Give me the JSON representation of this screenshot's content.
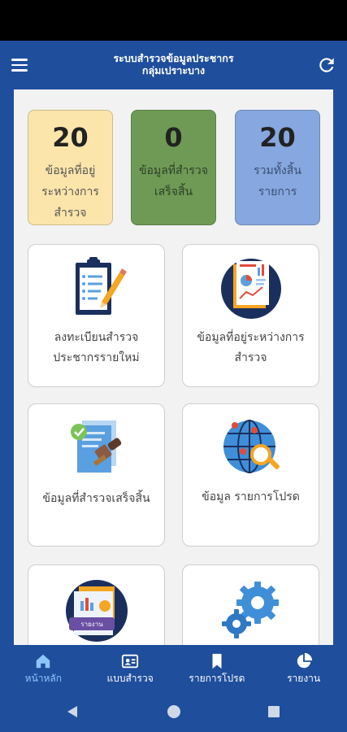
{
  "app": {
    "title_line1": "ระบบสำรวจข้อมูลประชากร",
    "title_line2": "กลุ่มเปราะบาง"
  },
  "stats": [
    {
      "value": "20",
      "label": "ข้อมูลที่อยู่ระหว่างการสำรวจ"
    },
    {
      "value": "0",
      "label": "ข้อมูลที่สำรวจเสร็จสิ้น"
    },
    {
      "value": "20",
      "label": "รวมทั้งสิ้น รายการ"
    }
  ],
  "tiles": [
    {
      "label": "ลงทะเบียนสำรวจ ประชากรรายใหม่"
    },
    {
      "label": "ข้อมูลที่อยู่ระหว่างการ สำรวจ"
    },
    {
      "label": "ข้อมูลที่สำรวจเสร็จสิ้น"
    },
    {
      "label": "ข้อมูล รายการโปรด"
    },
    {
      "badge": "รายงาน"
    }
  ],
  "bottom_nav": [
    {
      "label": "หน้าหลัก",
      "icon": "home-icon",
      "active": true
    },
    {
      "label": "แบบสำรวจ",
      "icon": "id-card-icon"
    },
    {
      "label": "รายการโปรด",
      "icon": "bookmark-icon"
    },
    {
      "label": "รายงาน",
      "icon": "pie-chart-icon"
    }
  ],
  "colors": {
    "primary": "#1f4e9c",
    "pending": "#fbe5ab",
    "done": "#6e9a55",
    "total": "#86a7df",
    "nav_active": "#8ec5ff"
  }
}
